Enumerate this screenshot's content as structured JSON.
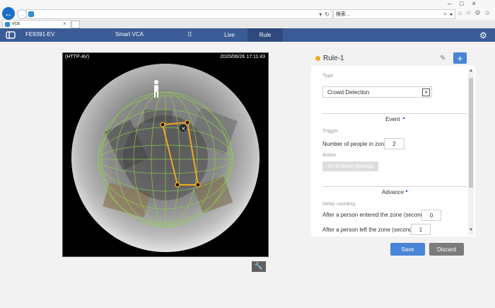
{
  "browser": {
    "address_text": "",
    "search_placeholder": "検索...",
    "tab_title": "vca",
    "tab_close": "×",
    "back_glyph": "←",
    "forward_glyph": "→",
    "window_controls": [
      "–",
      "□",
      "×"
    ],
    "addr_tools": [
      "▾",
      "↻"
    ],
    "search_tools": [
      "⌕",
      "▾"
    ],
    "right_tools": [
      "⌂",
      "☆",
      "⚙",
      "☺"
    ]
  },
  "nav": {
    "model": "FE9391-EV",
    "smart_vca": "Smart VCA",
    "grid_glyph": "⠿",
    "tabs": [
      {
        "label": "Live"
      },
      {
        "label": "Rule"
      }
    ],
    "active_tab": "Rule",
    "settings_glyph": "⚙"
  },
  "camera": {
    "protocol": "(HTTP-AV)",
    "timestamp": "2020/06/26 17:11:43",
    "zone_close_glyph": "×",
    "zone_color": "#f0a823"
  },
  "tools": {
    "wrench_glyph": "🔧"
  },
  "rule": {
    "name": "Rule-1",
    "status_color": "#f0a823",
    "edit_glyph": "✎",
    "add_glyph": "+"
  },
  "panel": {
    "type_label": "Type",
    "type_value": "Crowd Detection",
    "select_arrow": "▾",
    "event_header": "Event",
    "section_caret": "▲",
    "trigger_label": "Trigger",
    "people_label": "Number of people in zone:",
    "people_value": "2",
    "action_label": "Action",
    "event_button": "Go to Event Settings",
    "advance_header": "Advance",
    "delay_label": "Delay counting",
    "entered_label": "After a person entered the zone (seconds):",
    "entered_value": "0",
    "left_label": "After a person left the zone (seconds):",
    "left_value": "1",
    "scroll_up": "▲",
    "scroll_down": "▼"
  },
  "footer": {
    "save": "Save",
    "discard": "Discard"
  },
  "colors": {
    "nav": "#3a5b96",
    "accent": "#4a84d6",
    "active_tab": "#2e4a7c"
  }
}
